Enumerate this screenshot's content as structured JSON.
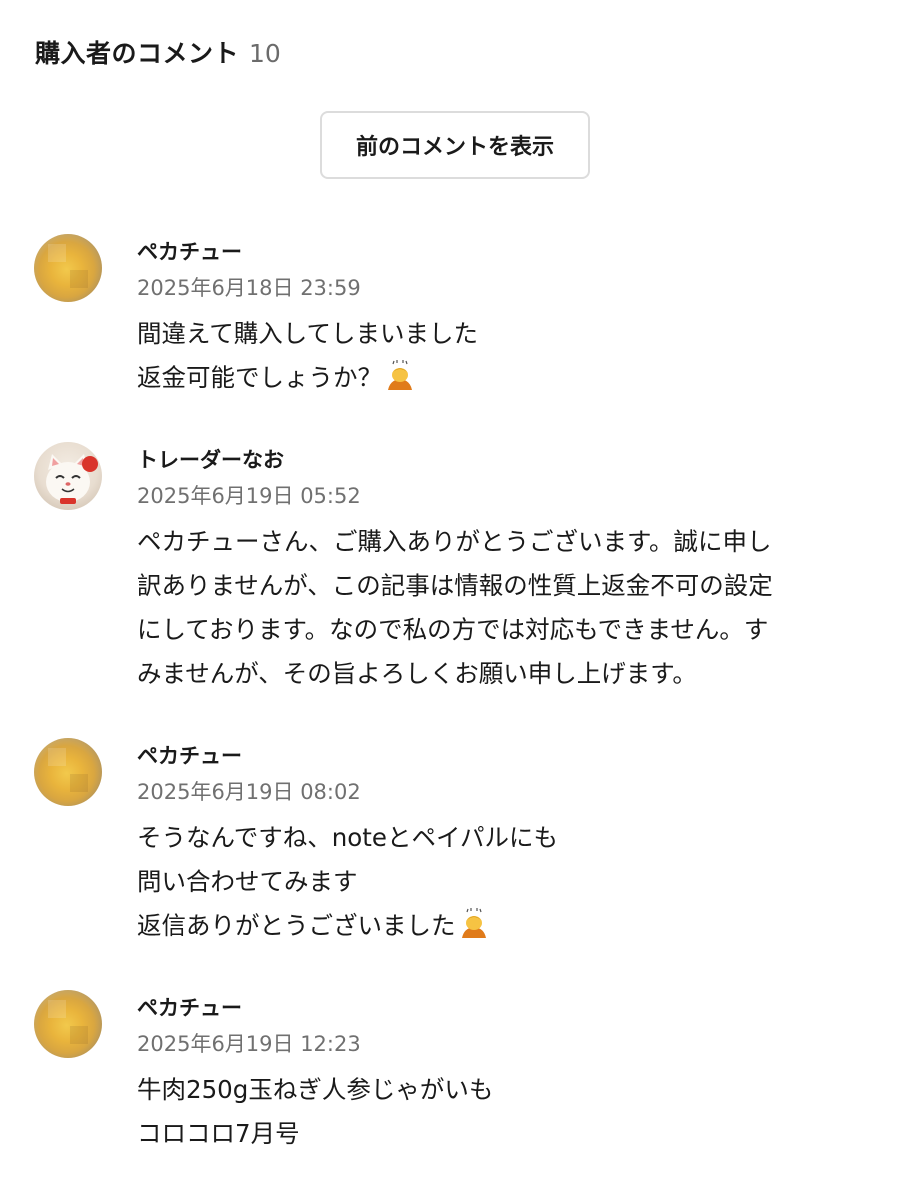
{
  "header": {
    "title": "購入者のコメント",
    "count": "10"
  },
  "show_previous_label": "前のコメントを表示",
  "comments": [
    {
      "author": "ペカチュー",
      "timestamp": "2025年6月18日 23:59",
      "lines": [
        "間違えて購入してしまいました",
        "返金可能でしょうか？"
      ],
      "avatar": "blurred-yellow-avatar",
      "emoji": "person-bowing-emoji"
    },
    {
      "author": "トレーダーなお",
      "timestamp": "2025年6月19日 05:52",
      "lines": [
        "ペカチューさん、ご購入ありがとうございます。誠に申し",
        "訳ありませんが、この記事は情報の性質上返金不可の設定",
        "にしております。なので私の方では対応もできません。す",
        "みませんが、その旨よろしくお願い申し上げます。"
      ],
      "avatar": "lucky-cat-avatar"
    },
    {
      "author": "ペカチュー",
      "timestamp": "2025年6月19日 08:02",
      "lines": [
        "そうなんですね、noteとペイパルにも",
        "問い合わせてみます",
        "返信ありがとうございました"
      ],
      "avatar": "blurred-yellow-avatar",
      "emoji": "person-bowing-emoji"
    },
    {
      "author": "ペカチュー",
      "timestamp": "2025年6月19日 12:23",
      "lines": [
        "牛肉250g玉ねぎ人参じゃがいも",
        "コロコロ7月号"
      ],
      "avatar": "blurred-yellow-avatar"
    }
  ]
}
